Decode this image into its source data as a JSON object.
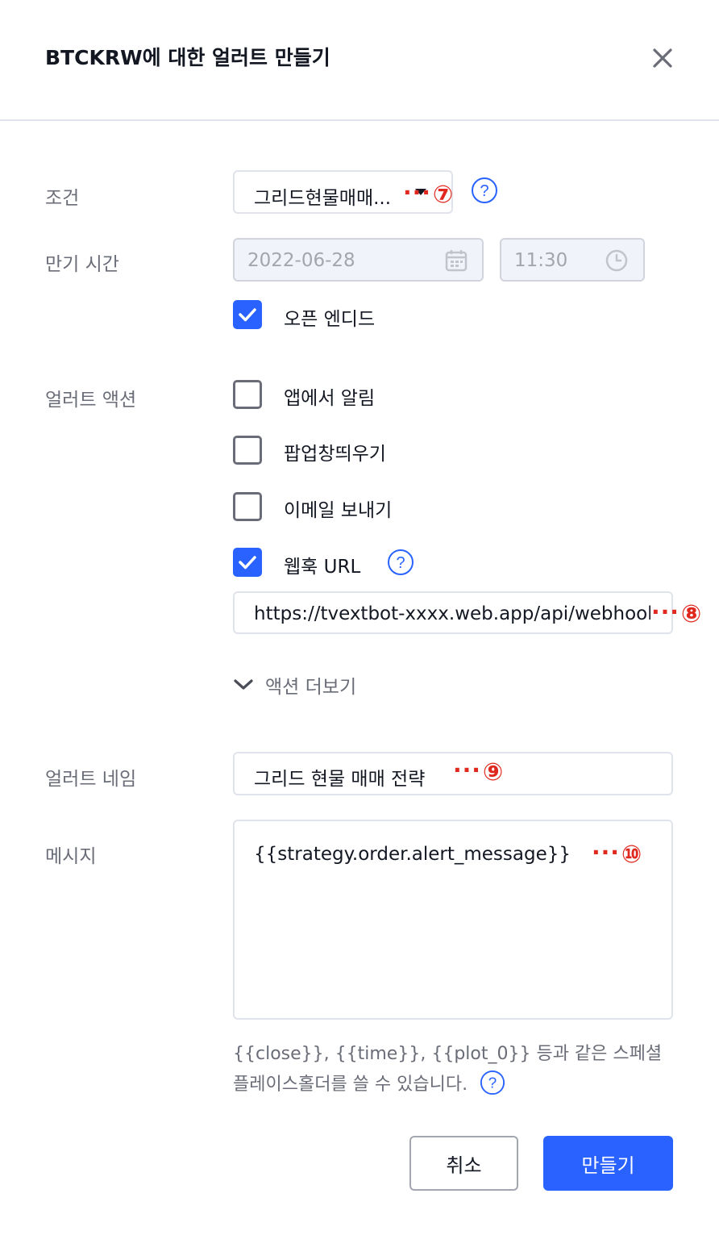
{
  "dialog": {
    "title": "BTCKRW에 대한 얼러트 만들기"
  },
  "condition": {
    "label": "조건",
    "value": "그리드현물매매...",
    "marker": "⑦"
  },
  "expiry": {
    "label": "만기 시간",
    "date": "2022-06-28",
    "time": "11:30",
    "open_ended_label": "오픈 엔디드",
    "open_ended_checked": true
  },
  "alert_actions": {
    "label": "얼러트 액션",
    "items": [
      {
        "label": "앱에서 알림",
        "checked": false
      },
      {
        "label": "팝업창띄우기",
        "checked": false
      },
      {
        "label": "이메일 보내기",
        "checked": false
      },
      {
        "label": "웹훅 URL",
        "checked": true
      }
    ],
    "webhook_url": "https://tvextbot-xxxx.web.app/api/webhook",
    "webhook_marker": "⑧",
    "more_label": "액션 더보기"
  },
  "alert_name": {
    "label": "얼러트 네임",
    "value": "그리드 현물 매매 전략",
    "marker": "⑨"
  },
  "message": {
    "label": "메시지",
    "value": "{{strategy.order.alert_message}}",
    "marker": "⑩"
  },
  "hint": {
    "text": "{{close}}, {{time}}, {{plot_0}} 등과 같은 스페셜 플레이스홀더를 쓸 수 있습니다."
  },
  "buttons": {
    "cancel": "취소",
    "create": "만들기"
  },
  "colors": {
    "accent": "#2962ff",
    "annotation": "#e0281e",
    "muted": "#6a6d78",
    "border": "#e0e3eb"
  }
}
